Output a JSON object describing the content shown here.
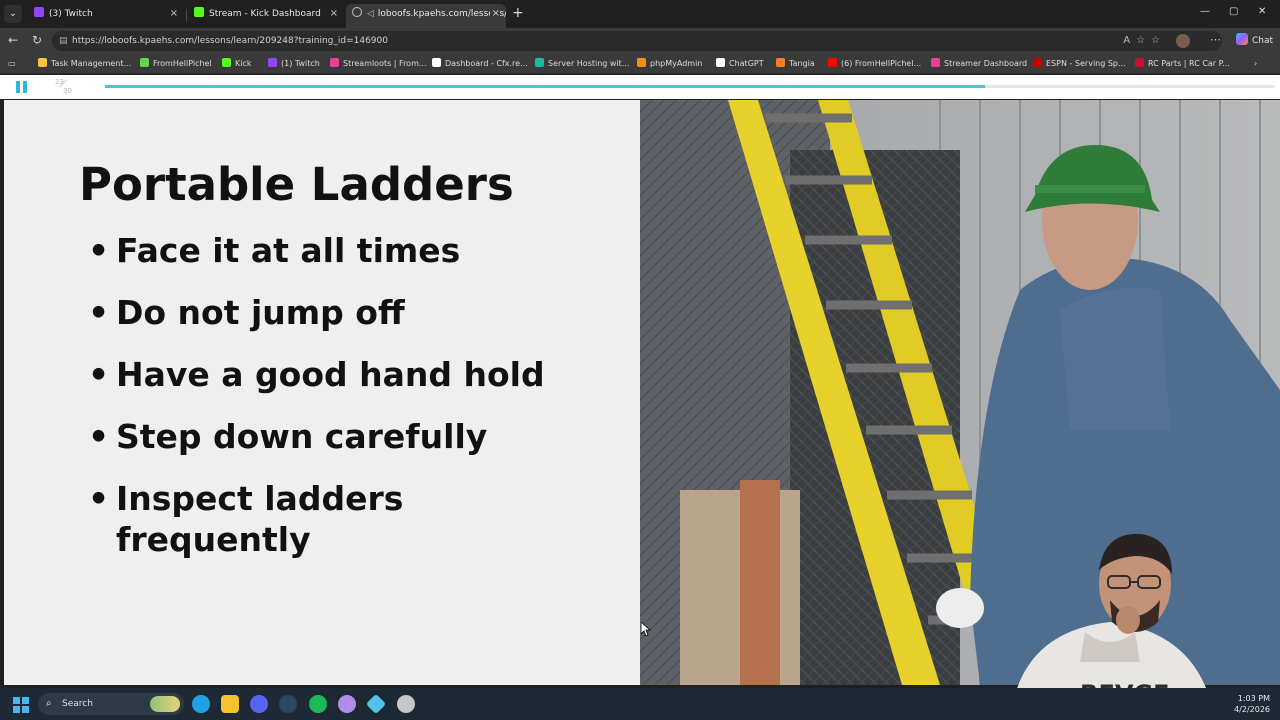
{
  "browser": {
    "tabs": [
      {
        "label": "(3) Twitch",
        "favicon_color": "#9146ff",
        "active": false
      },
      {
        "label": "Stream - Kick Dashboard",
        "favicon_color": "#53fc18",
        "active": false
      },
      {
        "label": "loboofs.kpaehs.com/lessons/l",
        "favicon_color": "#9aa0a6",
        "active": true
      }
    ],
    "close_glyph": "×",
    "new_tab_glyph": "+",
    "window_controls": {
      "minimize": "—",
      "maximize": "▢",
      "close": "✕"
    },
    "url": "https://loboofs.kpaehs.com/lessons/learn/209248?training_id=146900",
    "copilot_label": "Chat",
    "bookmarks": [
      {
        "label": "Task Management...",
        "color": "#f5c542"
      },
      {
        "label": "FromHellPichel",
        "color": "#6ad14b"
      },
      {
        "label": "Kick",
        "color": "#53fc18"
      },
      {
        "label": "(1) Twitch",
        "color": "#9146ff"
      },
      {
        "label": "Streamloots | From...",
        "color": "#e84393"
      },
      {
        "label": "Dashboard - Cfx.re...",
        "color": "#ffffff"
      },
      {
        "label": "Server Hosting wit...",
        "color": "#1abc9c"
      },
      {
        "label": "phpMyAdmin",
        "color": "#f29111"
      },
      {
        "label": "ChatGPT",
        "color": "#ffffff"
      },
      {
        "label": "Tangia",
        "color": "#ff7a2f"
      },
      {
        "label": "(6) FromHellPichel...",
        "color": "#ff0000"
      },
      {
        "label": "Streamer Dashboard",
        "color": "#e84393"
      },
      {
        "label": "ESPN - Serving Sp...",
        "color": "#d00000"
      },
      {
        "label": "RC Parts | RC Car P...",
        "color": "#c8102e"
      }
    ]
  },
  "player": {
    "current_slide": "23",
    "total_slides": "30",
    "progress_fraction": 0.752,
    "accent_color": "#4cc4d6"
  },
  "slide": {
    "title": "Portable Ladders",
    "bullets": [
      "Face it at all times",
      "Do not jump off",
      "Have a good hand hold",
      "Step down carefully",
      "Inspect ladders frequently"
    ]
  },
  "webcam_overlay_text": "REVGE",
  "taskbar": {
    "search_label": "Search",
    "time": "1:03 PM",
    "date": "4/2/2026",
    "apps": [
      {
        "name": "edge",
        "color": "#1fa1e6"
      },
      {
        "name": "file-explorer",
        "color": "#f4c430"
      },
      {
        "name": "discord",
        "color": "#5865f2"
      },
      {
        "name": "steam",
        "color": "#2a475e"
      },
      {
        "name": "spotify",
        "color": "#1db954"
      },
      {
        "name": "app-shell",
        "color": "#b58be8"
      },
      {
        "name": "app-kick",
        "color": "#53c0e8"
      },
      {
        "name": "app-settings",
        "color": "#c7c7c7"
      }
    ]
  }
}
